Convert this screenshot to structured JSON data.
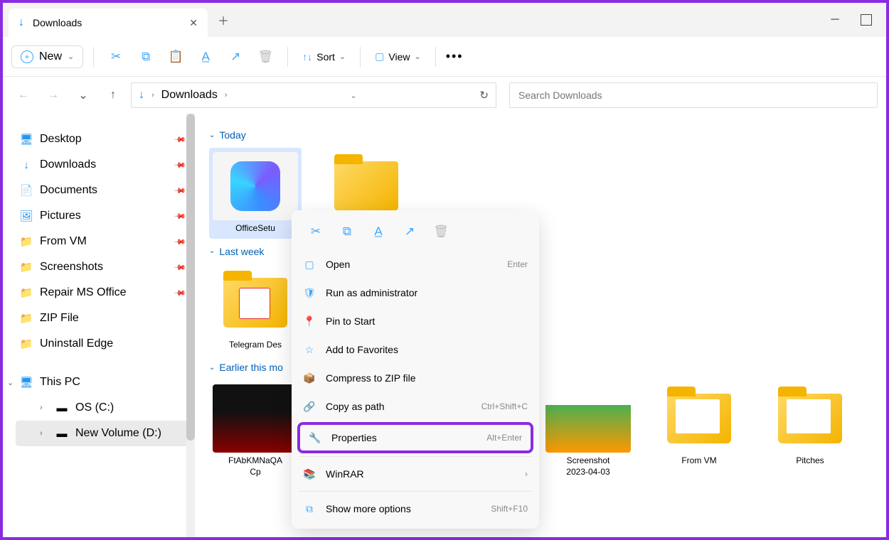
{
  "tab": {
    "title": "Downloads"
  },
  "toolbar": {
    "new": "New",
    "sort": "Sort",
    "view": "View"
  },
  "address": {
    "path": "Downloads"
  },
  "search": {
    "placeholder": "Search Downloads"
  },
  "sidebar": {
    "items": [
      {
        "label": "Desktop"
      },
      {
        "label": "Downloads"
      },
      {
        "label": "Documents"
      },
      {
        "label": "Pictures"
      },
      {
        "label": "From VM"
      },
      {
        "label": "Screenshots"
      },
      {
        "label": "Repair MS Office"
      },
      {
        "label": "ZIP File"
      },
      {
        "label": "Uninstall Edge"
      }
    ],
    "thispc": "This PC",
    "drives": [
      {
        "label": "OS (C:)"
      },
      {
        "label": "New Volume (D:)"
      }
    ]
  },
  "groups": {
    "today": "Today",
    "lastweek": "Last week",
    "earlier": "Earlier this mo"
  },
  "files": {
    "office": "OfficeSetu",
    "telegram": "Telegram Des",
    "ftab": "FtAbKMNaQA\nCp",
    "date1": "2023-04-03",
    "date2": "2023-04-03",
    "screenshot": "Screenshot\n2023-04-03",
    "fromvm": "From VM",
    "pitches": "Pitches"
  },
  "ctx": {
    "open": "Open",
    "open_sc": "Enter",
    "runadmin": "Run as administrator",
    "pin": "Pin to Start",
    "fav": "Add to Favorites",
    "zip": "Compress to ZIP file",
    "copypath": "Copy as path",
    "copypath_sc": "Ctrl+Shift+C",
    "props": "Properties",
    "props_sc": "Alt+Enter",
    "winrar": "WinRAR",
    "more": "Show more options",
    "more_sc": "Shift+F10"
  }
}
